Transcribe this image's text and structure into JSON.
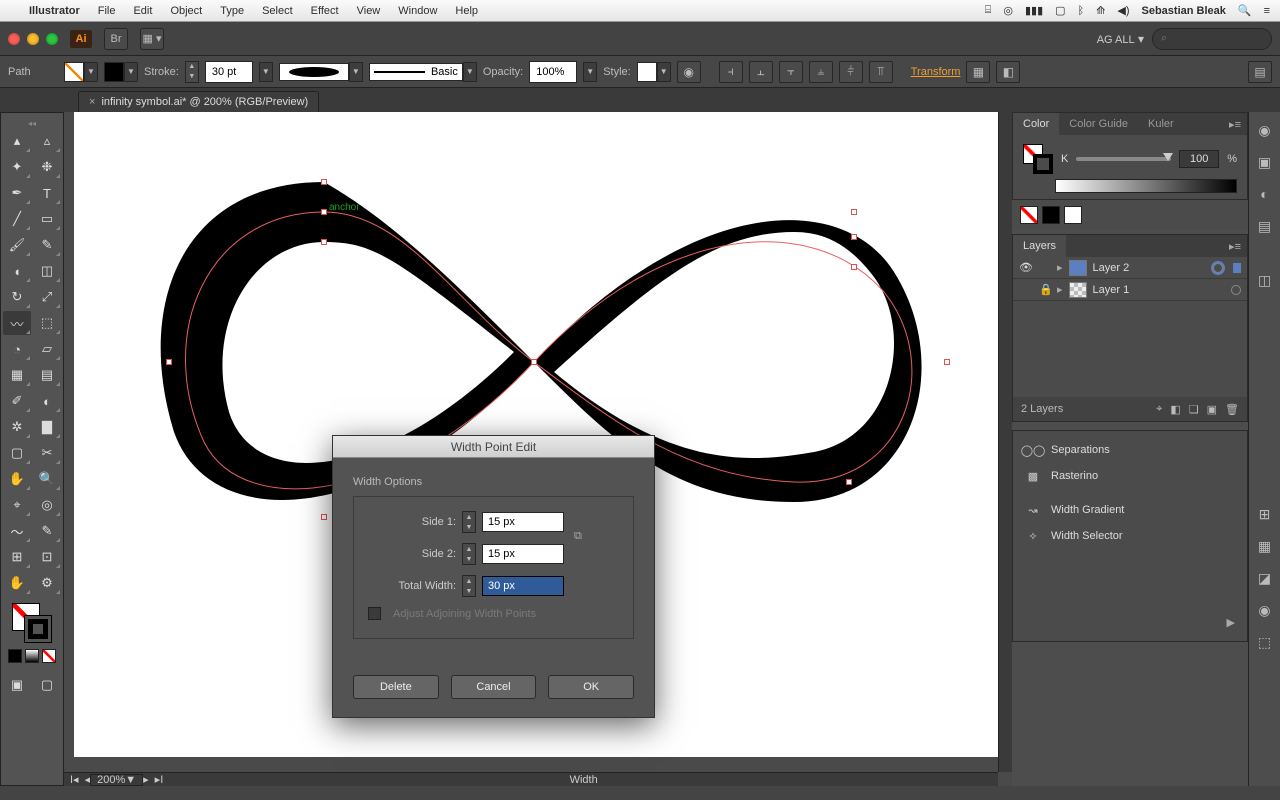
{
  "mac_menu": {
    "app": "Illustrator",
    "items": [
      "File",
      "Edit",
      "Object",
      "Type",
      "Select",
      "Effect",
      "View",
      "Window",
      "Help"
    ],
    "user": "Sebastian Bleak"
  },
  "app_bar": {
    "workspace": "AG ALL",
    "search_placeholder": "⌕"
  },
  "control": {
    "selection": "Path",
    "stroke_label": "Stroke:",
    "stroke_value": "30 pt",
    "profile_label": "Basic",
    "opacity_label": "Opacity:",
    "opacity_value": "100%",
    "style_label": "Style:",
    "transform": "Transform"
  },
  "document": {
    "tab": "infinity symbol.ai* @ 200% (RGB/Preview)"
  },
  "canvas": {
    "anchor_label": "anchor"
  },
  "panels": {
    "color": {
      "tabs": [
        "Color",
        "Color Guide",
        "Kuler"
      ],
      "k": "K",
      "value": "100",
      "pct": "%"
    },
    "layers": {
      "tab": "Layers",
      "items": [
        {
          "name": "Layer 2",
          "thumb": "blue",
          "locked": false,
          "double": true
        },
        {
          "name": "Layer 1",
          "thumb": "check",
          "locked": true,
          "double": false
        }
      ],
      "footer": "2 Layers"
    },
    "plugins": [
      "Separations",
      "Rasterino",
      "Width Gradient",
      "Width Selector"
    ]
  },
  "dialog": {
    "title": "Width Point Edit",
    "section": "Width Options",
    "side1_label": "Side 1:",
    "side1_value": "15 px",
    "side2_label": "Side 2:",
    "side2_value": "15 px",
    "total_label": "Total Width:",
    "total_value": "30 px",
    "adjust_label": "Adjust Adjoining Width Points",
    "delete": "Delete",
    "cancel": "Cancel",
    "ok": "OK"
  },
  "status": {
    "zoom": "200%",
    "tool": "Width"
  }
}
